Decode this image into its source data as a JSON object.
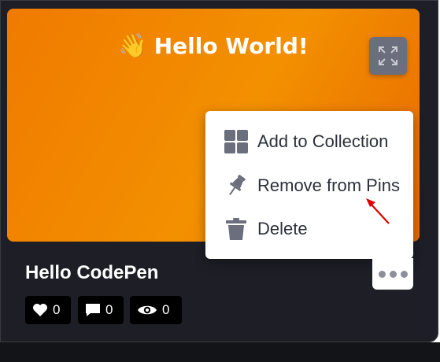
{
  "preview": {
    "emoji": "👋",
    "title": "Hello World!"
  },
  "menu": {
    "items": [
      {
        "label": "Add to Collection",
        "icon": "grid-icon"
      },
      {
        "label": "Remove from Pins",
        "icon": "pin-icon"
      },
      {
        "label": "Delete",
        "icon": "trash-icon"
      }
    ]
  },
  "pen": {
    "title": "Hello CodePen"
  },
  "stats": {
    "likes": "0",
    "comments": "0",
    "views": "0"
  },
  "colors": {
    "preview_bg": "#f07a00",
    "card_bg": "#1e1f26",
    "menu_text": "#2c303a",
    "icon_gray": "#6b6e7d",
    "annotation_arrow": "#e00000"
  }
}
